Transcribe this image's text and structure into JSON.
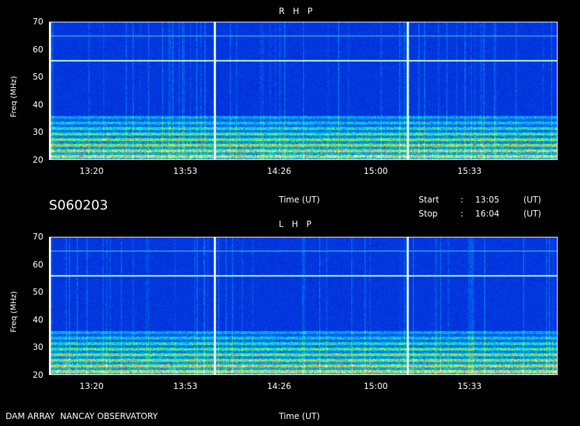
{
  "observation_id": "S060203",
  "observatory": "DAM ARRAY  NANCAY OBSERVATORY",
  "time_label": "Time (UT)",
  "start": {
    "label": "Start",
    "sep": ":",
    "value": "13:05",
    "unit": "(UT)"
  },
  "stop": {
    "label": "Stop",
    "sep": ":",
    "value": "16:04",
    "unit": "(UT)"
  },
  "colors": {
    "background": "#000000",
    "text": "#ffffff",
    "spectrum_base": "#0020c8",
    "axis": "#ffffff"
  },
  "chart_data": [
    {
      "type": "heatmap",
      "title": "R H P",
      "ylabel": "Freq (MHz)",
      "xlabel": "Time (UT)",
      "xlim": [
        "13:05",
        "16:04"
      ],
      "ylim": [
        20,
        70
      ],
      "y_ticks": [
        20,
        30,
        40,
        50,
        60,
        70
      ],
      "x_ticks": [
        "13:20",
        "13:53",
        "14:26",
        "15:00",
        "15:33"
      ],
      "calibration_lines_utc": [
        "13:05",
        "14:03",
        "15:11"
      ],
      "persistent_emission_mhz": [
        56,
        65
      ],
      "enhanced_band_mhz": [
        20,
        36
      ]
    },
    {
      "type": "heatmap",
      "title": "L H P",
      "ylabel": "Freq (MHz)",
      "xlabel": "Time (UT)",
      "xlim": [
        "13:05",
        "16:04"
      ],
      "ylim": [
        20,
        70
      ],
      "y_ticks": [
        20,
        30,
        40,
        50,
        60,
        70
      ],
      "x_ticks": [
        "13:20",
        "13:53",
        "14:26",
        "15:00",
        "15:33"
      ],
      "calibration_lines_utc": [
        "13:05",
        "14:03",
        "15:11"
      ],
      "persistent_emission_mhz": [
        56,
        65
      ],
      "enhanced_band_mhz": [
        20,
        36
      ]
    }
  ]
}
